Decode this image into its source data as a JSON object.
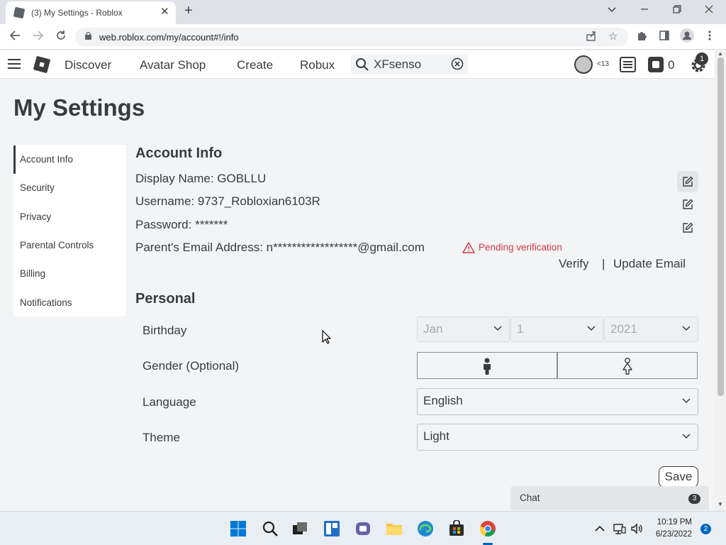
{
  "browser": {
    "tab_title": "(3) My Settings - Roblox",
    "url": "web.roblox.com/my/account#!/info"
  },
  "header": {
    "nav": [
      "Discover",
      "Avatar Shop",
      "Create",
      "Robux"
    ],
    "search_value": "XFsenso",
    "age_label": "<13",
    "robux_count": "0",
    "notification_count": "1"
  },
  "page": {
    "title": "My Settings"
  },
  "sidebar": {
    "items": [
      {
        "label": "Account Info",
        "active": true
      },
      {
        "label": "Security"
      },
      {
        "label": "Privacy"
      },
      {
        "label": "Parental Controls"
      },
      {
        "label": "Billing"
      },
      {
        "label": "Notifications"
      }
    ]
  },
  "account_info": {
    "heading": "Account Info",
    "display_name": "Display Name: GOBLLU",
    "username": "Username: 9737_Robloxian6103R",
    "password": "Password: *******",
    "parent_email": "Parent's Email Address: n******************@gmail.com",
    "pending": "Pending verification",
    "verify": "Verify",
    "separator": "|",
    "update_email": "Update Email"
  },
  "personal": {
    "heading": "Personal",
    "birthday_label": "Birthday",
    "birth_month": "Jan",
    "birth_day": "1",
    "birth_year": "2021",
    "gender_label": "Gender (Optional)",
    "language_label": "Language",
    "language_value": "English",
    "theme_label": "Theme",
    "theme_value": "Light",
    "save": "Save"
  },
  "chat": {
    "label": "Chat",
    "count": "3"
  },
  "taskbar": {
    "time": "10:19 PM",
    "date": "6/23/2022",
    "notification_count": "2"
  },
  "colors": {
    "error": "#d8394b",
    "text": "#393b3d",
    "page_bg": "#f2f4f5",
    "accent": "#0067c0"
  }
}
